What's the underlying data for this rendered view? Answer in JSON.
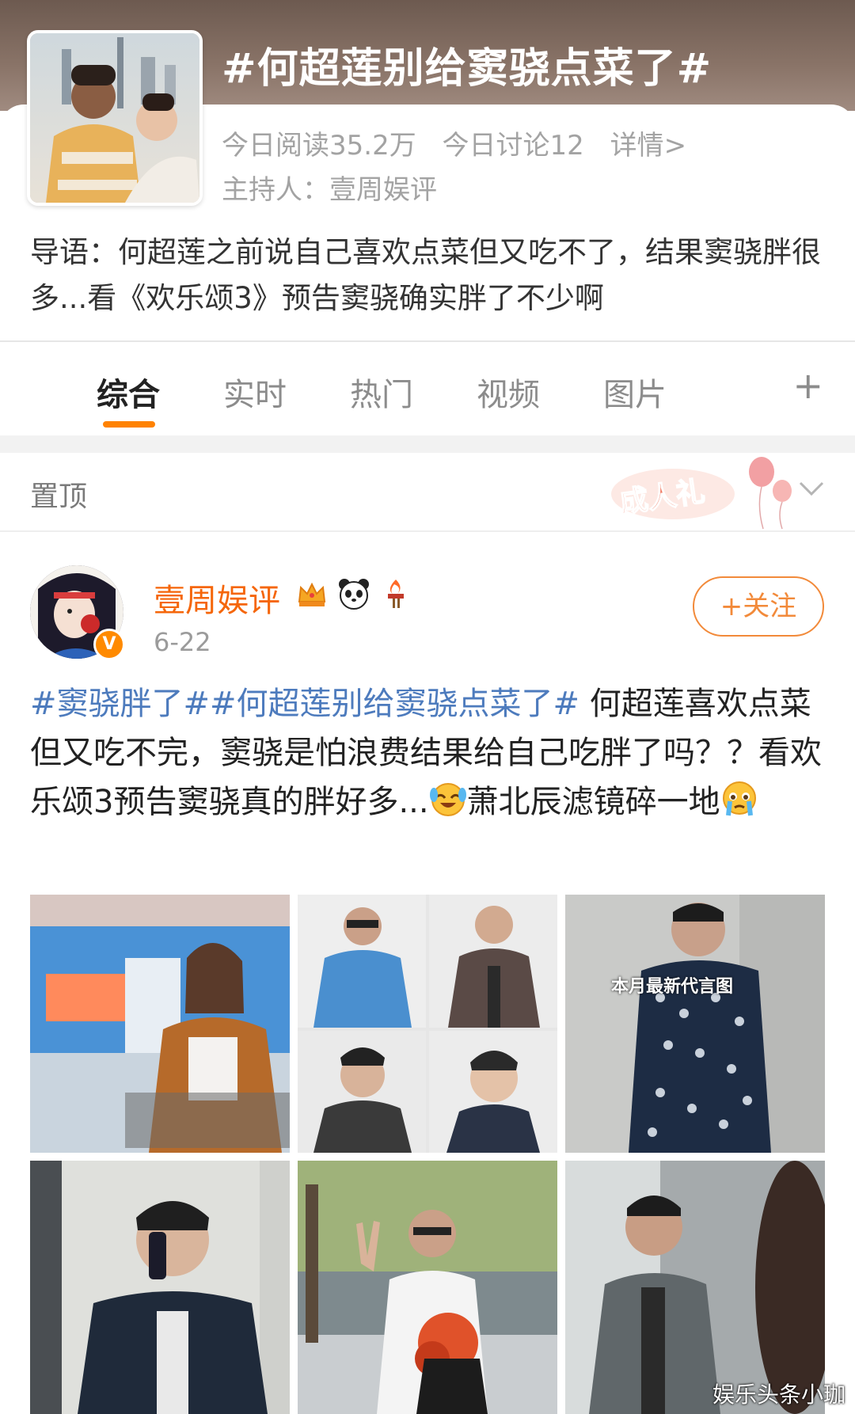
{
  "topic": {
    "title": "#何超莲别给窦骁点菜了#",
    "reads_today": "今日阅读35.2万",
    "discussions_today": "今日讨论12",
    "details_link": "详情>",
    "host": "主持人：壹周娱评",
    "intro": "导语：何超莲之前说自己喜欢点菜但又吃不了，结果窦骁胖很多...看《欢乐颂3》预告窦骁确实胖了不少啊"
  },
  "tabs": [
    {
      "label": "综合",
      "active": true
    },
    {
      "label": "实时",
      "active": false
    },
    {
      "label": "热门",
      "active": false
    },
    {
      "label": "视频",
      "active": false
    },
    {
      "label": "图片",
      "active": false
    }
  ],
  "tab_more": "+",
  "pinned": {
    "label": "置顶",
    "badge_text": "成人礼"
  },
  "post": {
    "username": "壹周娱评",
    "date": "6-22",
    "follow_label": "+关注",
    "verified_mark": "V",
    "tag1": "#窦骁胖了#",
    "tag2": "#何超莲别给窦骁点菜了#",
    "text_part1": " 何超莲喜欢点菜但又吃不完，窦骁是怕浪费结果给自己吃胖了吗？？看欢乐颂3预告窦骁真的胖好多...",
    "text_part2": "萧北辰滤镜碎一地",
    "emoji1": "laugh-cry",
    "emoji2": "teary-face",
    "image_overlay_text": "本月最新代言图"
  },
  "watermark": "娱乐头条小珈",
  "colors": {
    "accent": "#ff8200",
    "username": "#f5660a",
    "hashtag": "#4d7bbd",
    "follow": "#f28a3a"
  }
}
